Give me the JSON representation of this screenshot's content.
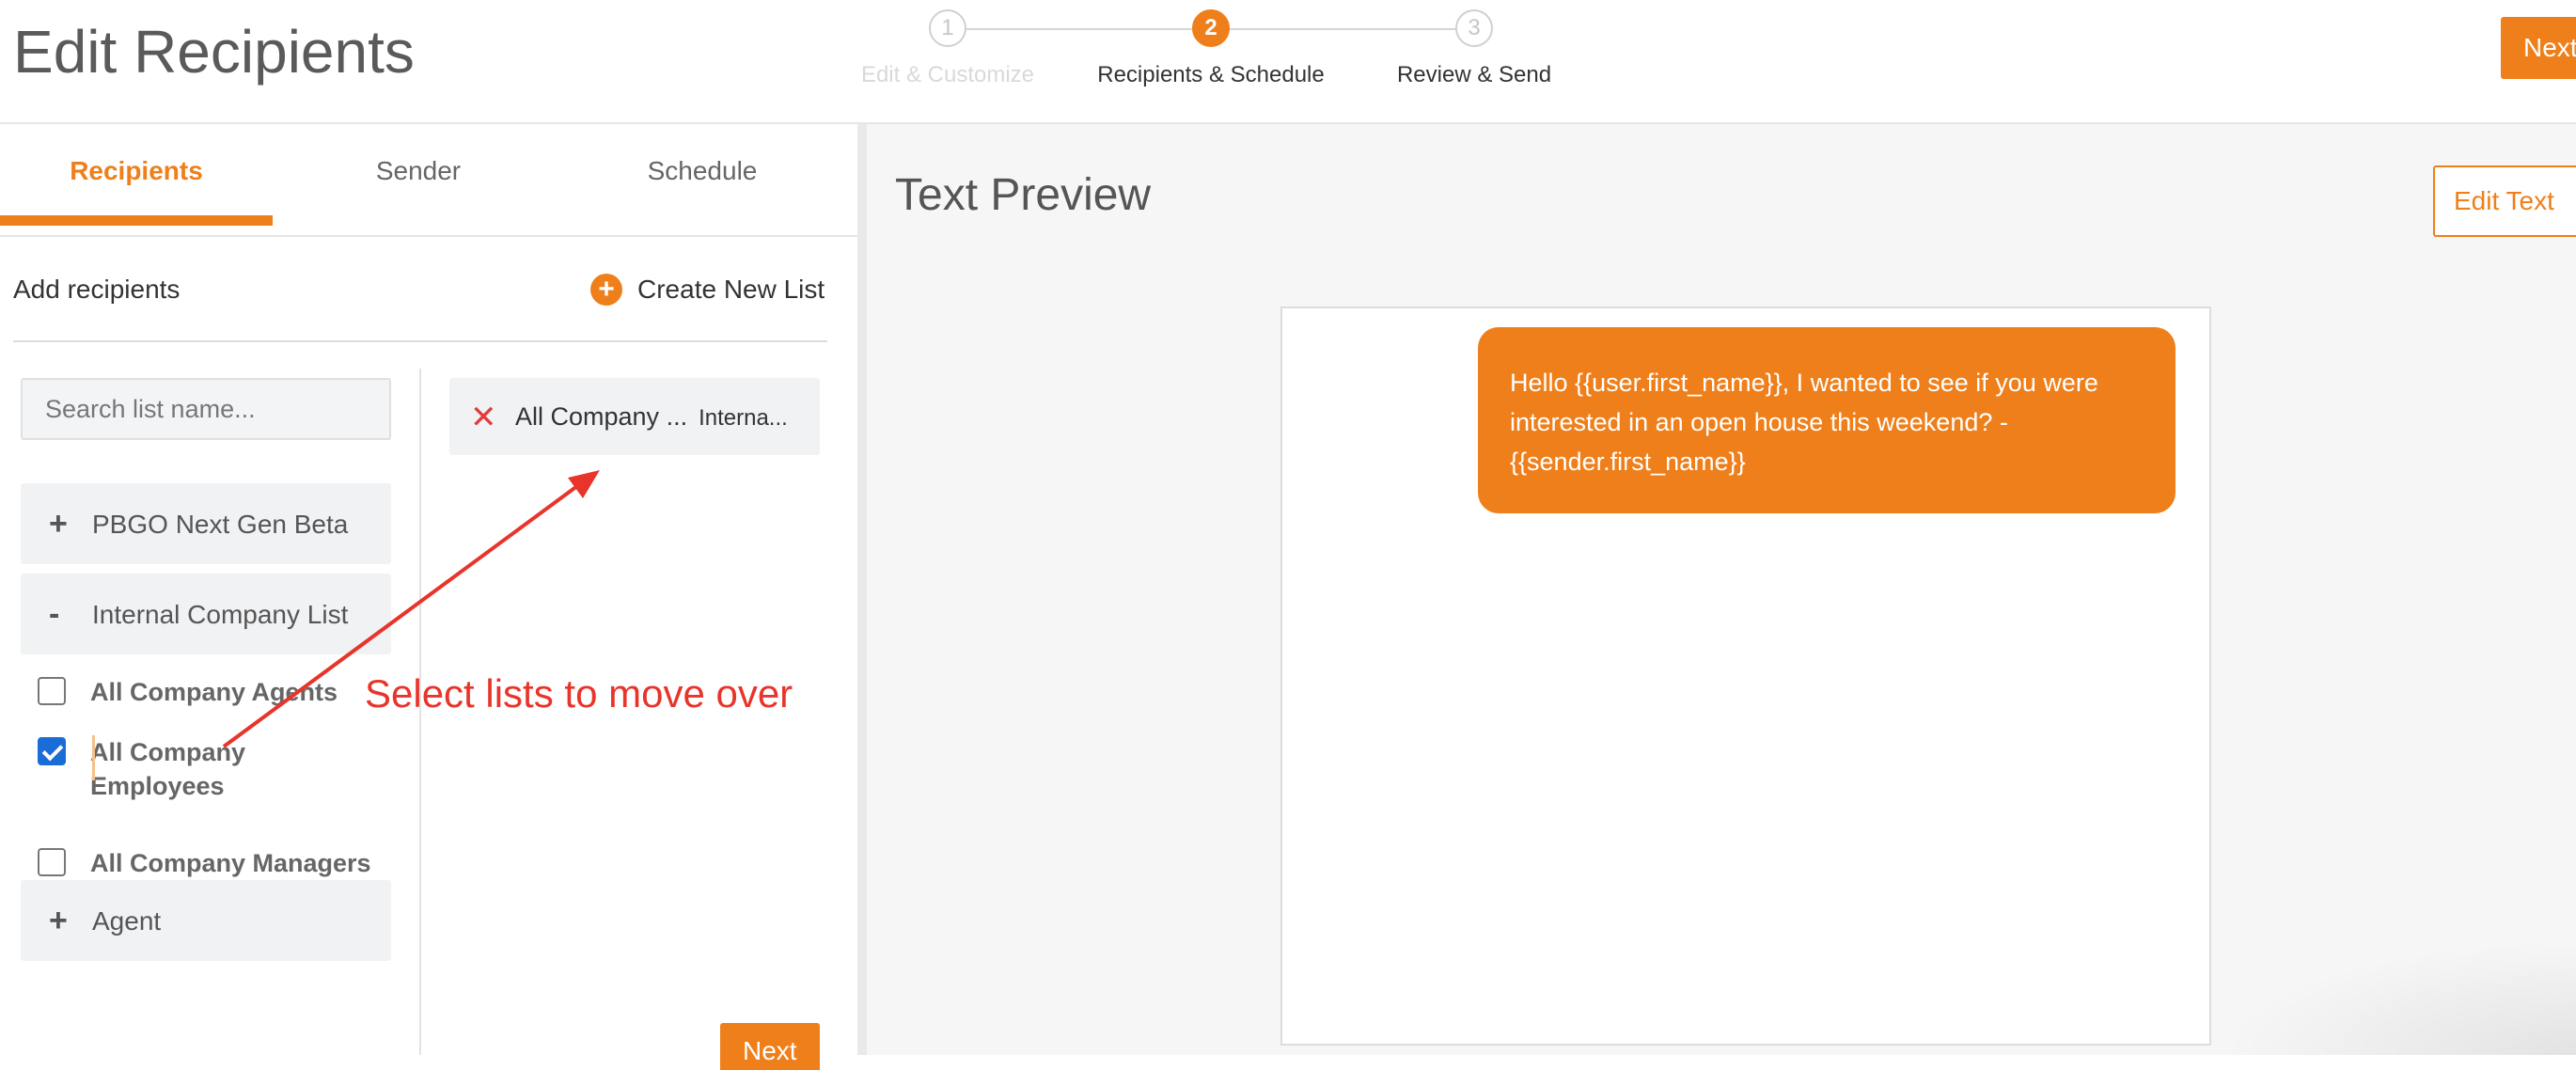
{
  "header": {
    "title": "Edit Recipients",
    "steps": [
      {
        "number": "1",
        "label": "Edit & Customize",
        "state": "completed"
      },
      {
        "number": "2",
        "label": "Recipients & Schedule",
        "state": "active"
      },
      {
        "number": "3",
        "label": "Review & Send",
        "state": "upcoming"
      }
    ],
    "next_label": "Next"
  },
  "left_panel": {
    "tabs": [
      "Recipients",
      "Sender",
      "Schedule"
    ],
    "active_tab": "Recipients",
    "add_recipients_label": "Add recipients",
    "create_list_label": "Create New List",
    "search": {
      "placeholder": "Search list name...",
      "value": ""
    },
    "groups": [
      {
        "sign": "+",
        "label": "PBGO Next Gen Beta",
        "expanded": false
      },
      {
        "sign": "-",
        "label": "Internal Company List",
        "expanded": true
      },
      {
        "sign": "+",
        "label": "Agent",
        "expanded": false
      }
    ],
    "lists": [
      {
        "label": "All Company Agents",
        "checked": false
      },
      {
        "label": "All Company Employees",
        "checked": true
      },
      {
        "label": "All Company Managers",
        "checked": false
      }
    ],
    "selected": [
      {
        "name": "All Company ...",
        "group": "Interna..."
      }
    ],
    "next_label": "Next"
  },
  "annotation": {
    "text": "Select lists to move over",
    "color": "#e8342a"
  },
  "right_panel": {
    "title": "Text Preview",
    "edit_label": "Edit Text",
    "message": "Hello {{user.first_name}}, I wanted to see if you were interested in an open house this weekend? - {{sender.first_name}}"
  },
  "colors": {
    "accent": "#ef7f1a",
    "checkbox": "#1a6dd6",
    "remove": "#e23b3b"
  }
}
